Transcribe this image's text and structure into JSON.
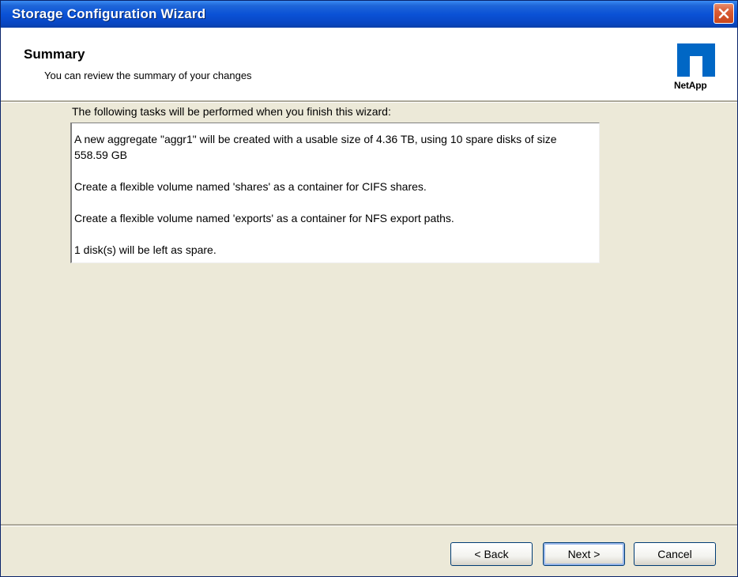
{
  "window": {
    "title": "Storage Configuration Wizard"
  },
  "header": {
    "title": "Summary",
    "subtitle": "You can review the summary of your changes",
    "logo_text": "NetApp"
  },
  "body": {
    "tasks_label": "The following tasks will be performed when you finish this wizard:",
    "tasks": [
      "A new aggregate \"aggr1\" will be created with a usable size of 4.36 TB, using 10 spare disks of size 558.59 GB",
      "Create a flexible volume named 'shares' as a container for CIFS shares.",
      "Create a flexible volume named 'exports' as a container for NFS export paths.",
      "1 disk(s) will be left as spare."
    ]
  },
  "buttons": {
    "back": "< Back",
    "next": "Next >",
    "cancel": "Cancel"
  },
  "colors": {
    "titlebar": "#0a52d6",
    "dialog_bg": "#ece9d8",
    "close_button": "#d85b34",
    "logo": "#0067c5"
  },
  "icons": {
    "close": "close-x-icon",
    "logo": "netapp-logo-icon"
  }
}
